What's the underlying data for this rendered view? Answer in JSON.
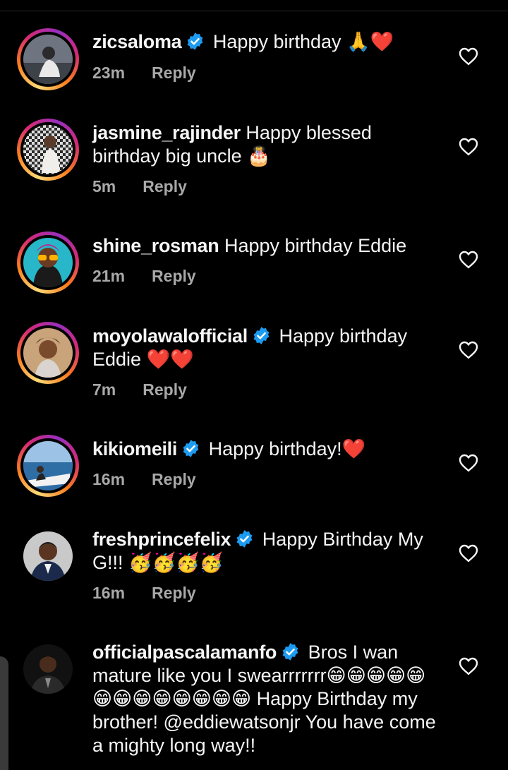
{
  "colors": {
    "background": "#000000",
    "text": "#f5f5f5",
    "meta": "#a8a8a8",
    "verified": "#1d9bf0",
    "heart_emoji": "#e0102d"
  },
  "comments": [
    {
      "username": "zicsaloma",
      "verified": true,
      "text": "Happy birthday 🙏❤️",
      "time": "23m",
      "reply": "Reply",
      "avatar_icon": "avatar-photo",
      "story_ring": true
    },
    {
      "username": "jasmine_rajinder",
      "verified": false,
      "text": "Happy blessed birthday big uncle 🎂",
      "time": "5m",
      "reply": "Reply",
      "avatar_icon": "avatar-photo",
      "story_ring": true
    },
    {
      "username": "shine_rosman",
      "verified": false,
      "text": "Happy birthday Eddie",
      "time": "21m",
      "reply": "Reply",
      "avatar_icon": "avatar-photo",
      "story_ring": true
    },
    {
      "username": "moyolawalofficial",
      "verified": true,
      "text": "Happy birthday Eddie ❤️❤️",
      "time": "7m",
      "reply": "Reply",
      "avatar_icon": "avatar-photo",
      "story_ring": true
    },
    {
      "username": "kikiomeili",
      "verified": true,
      "text": "Happy birthday!❤️",
      "time": "16m",
      "reply": "Reply",
      "avatar_icon": "avatar-photo",
      "story_ring": true
    },
    {
      "username": "freshprincefelix",
      "verified": true,
      "text": "Happy Birthday My G!!! 🥳🥳🥳🥳",
      "time": "16m",
      "reply": "Reply",
      "avatar_icon": "avatar-photo",
      "story_ring": false
    },
    {
      "username": "officialpascalamanfo",
      "verified": true,
      "text": "Bros I wan mature like you I swearrrrrrr😁😁😁😁😁😁😁😁😁😁😁😁😁 Happy Birthday my brother! @eddiewatsonjr You have come a mighty long way!!",
      "time": "",
      "reply": "",
      "avatar_icon": "avatar-photo",
      "story_ring": false
    }
  ],
  "icons": {
    "like": "heart-outline-icon",
    "verified": "verified-badge-icon"
  }
}
